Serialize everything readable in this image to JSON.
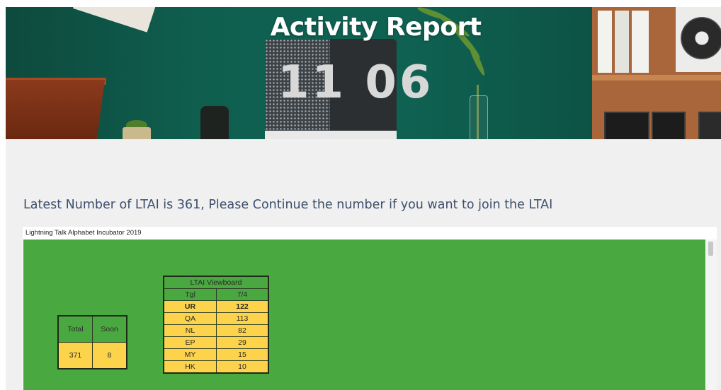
{
  "header": {
    "title": "Activity Report"
  },
  "hero": {
    "clock_display": "11 06"
  },
  "announcement": "Latest Number of LTAI is 361, Please Continue the number if you want to join the LTAI",
  "embed": {
    "title": "Lightning Talk Alphabet Incubator 2019",
    "background_color": "#4aa840",
    "cell_color": "#fcd34a"
  },
  "totals_table": {
    "headers": [
      "Total",
      "Soon"
    ],
    "values": [
      "371",
      "8"
    ]
  },
  "viewboard": {
    "title": "LTAI Viewboard",
    "header_left": "Tgl",
    "header_right": "7/4",
    "rows": [
      {
        "code": "UR",
        "count": "122"
      },
      {
        "code": "QA",
        "count": "113"
      },
      {
        "code": "NL",
        "count": "82"
      },
      {
        "code": "EP",
        "count": "29"
      },
      {
        "code": "MY",
        "count": "15"
      },
      {
        "code": "HK",
        "count": "10"
      }
    ]
  }
}
